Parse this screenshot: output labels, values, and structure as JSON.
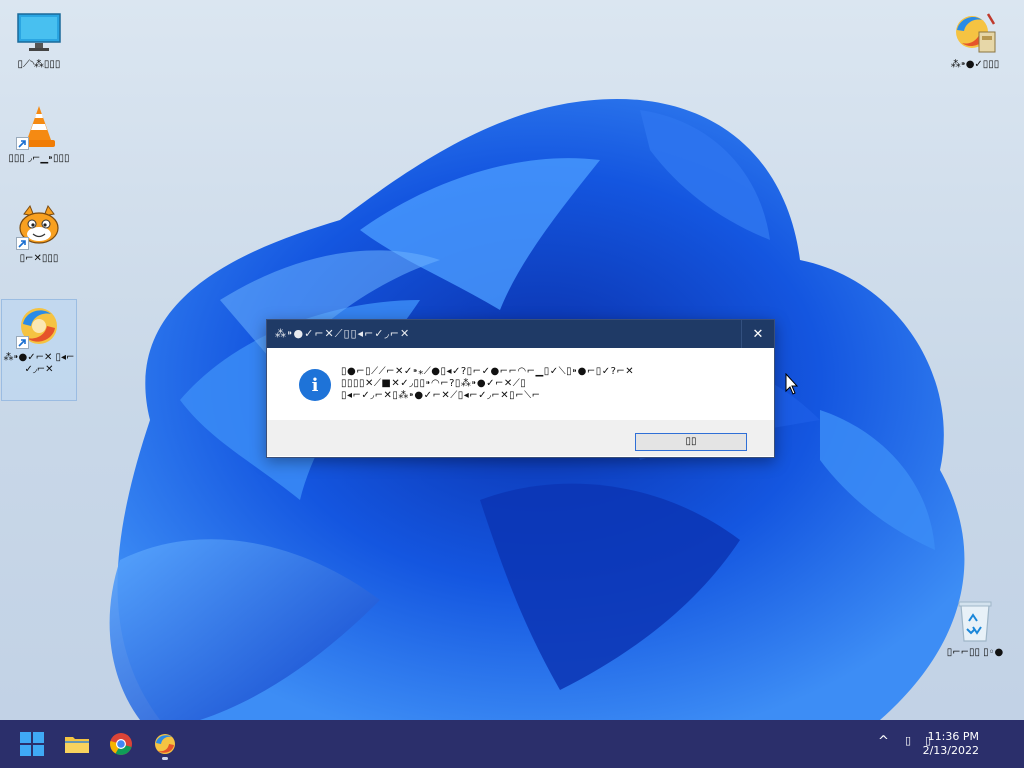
{
  "desktop": {
    "icons": [
      {
        "id": "this-pc",
        "label": "▯⟋◝⁂▯▯▯"
      },
      {
        "id": "vlc",
        "label": "▯▯▯ ◞⌐▁⁍▯▯▯"
      },
      {
        "id": "scratch",
        "label": "▯⌐✕▯▯▯"
      },
      {
        "id": "app-installer",
        "label": "⁂⁍●✓⌐✕ ▯◂⌐✓◞⌐✕"
      },
      {
        "id": "setup-top-right",
        "label": "⁂⁍●✓▯▯▯"
      },
      {
        "id": "recycle-bin",
        "label": "▯⌐⌐▯▯ ▯◦●"
      }
    ]
  },
  "dialog": {
    "title": "⁂⁍●✓⌐✕⟋▯▯◂⌐✓◞⌐✕",
    "close_label": "✕",
    "message_line1": "▯●⌐▯⟋⟋⌐✕✓⁍⁎⟋●▯◂✓?▯⌐✓●⌐⌐◠⌐▁▯✓⟍▯⁍●⌐▯✓?⌐✕",
    "message_line2": "▯▯▯▯✕⟋■✕✓◞▯▯⁍◠⌐?▯⁂⁍●✓⌐✕⟋▯",
    "message_line3": "▯◂⌐✓◞⌐✕▯⁂⁍●✓⌐✕⟋▯◂⌐✓◞⌐✕▯⌐⟍⌐",
    "ok_label": "▯▯"
  },
  "taskbar": {
    "clock_time": "11:36 PM",
    "clock_date": "2/13/2022",
    "tray_chevron": "^",
    "tray_icon_1": "▯",
    "tray_icon_2": "▯"
  },
  "colors": {
    "taskbar_bg": "#2b2f6b",
    "dialog_title_bg": "#1f3a66",
    "accent_blue": "#1e73d8"
  }
}
